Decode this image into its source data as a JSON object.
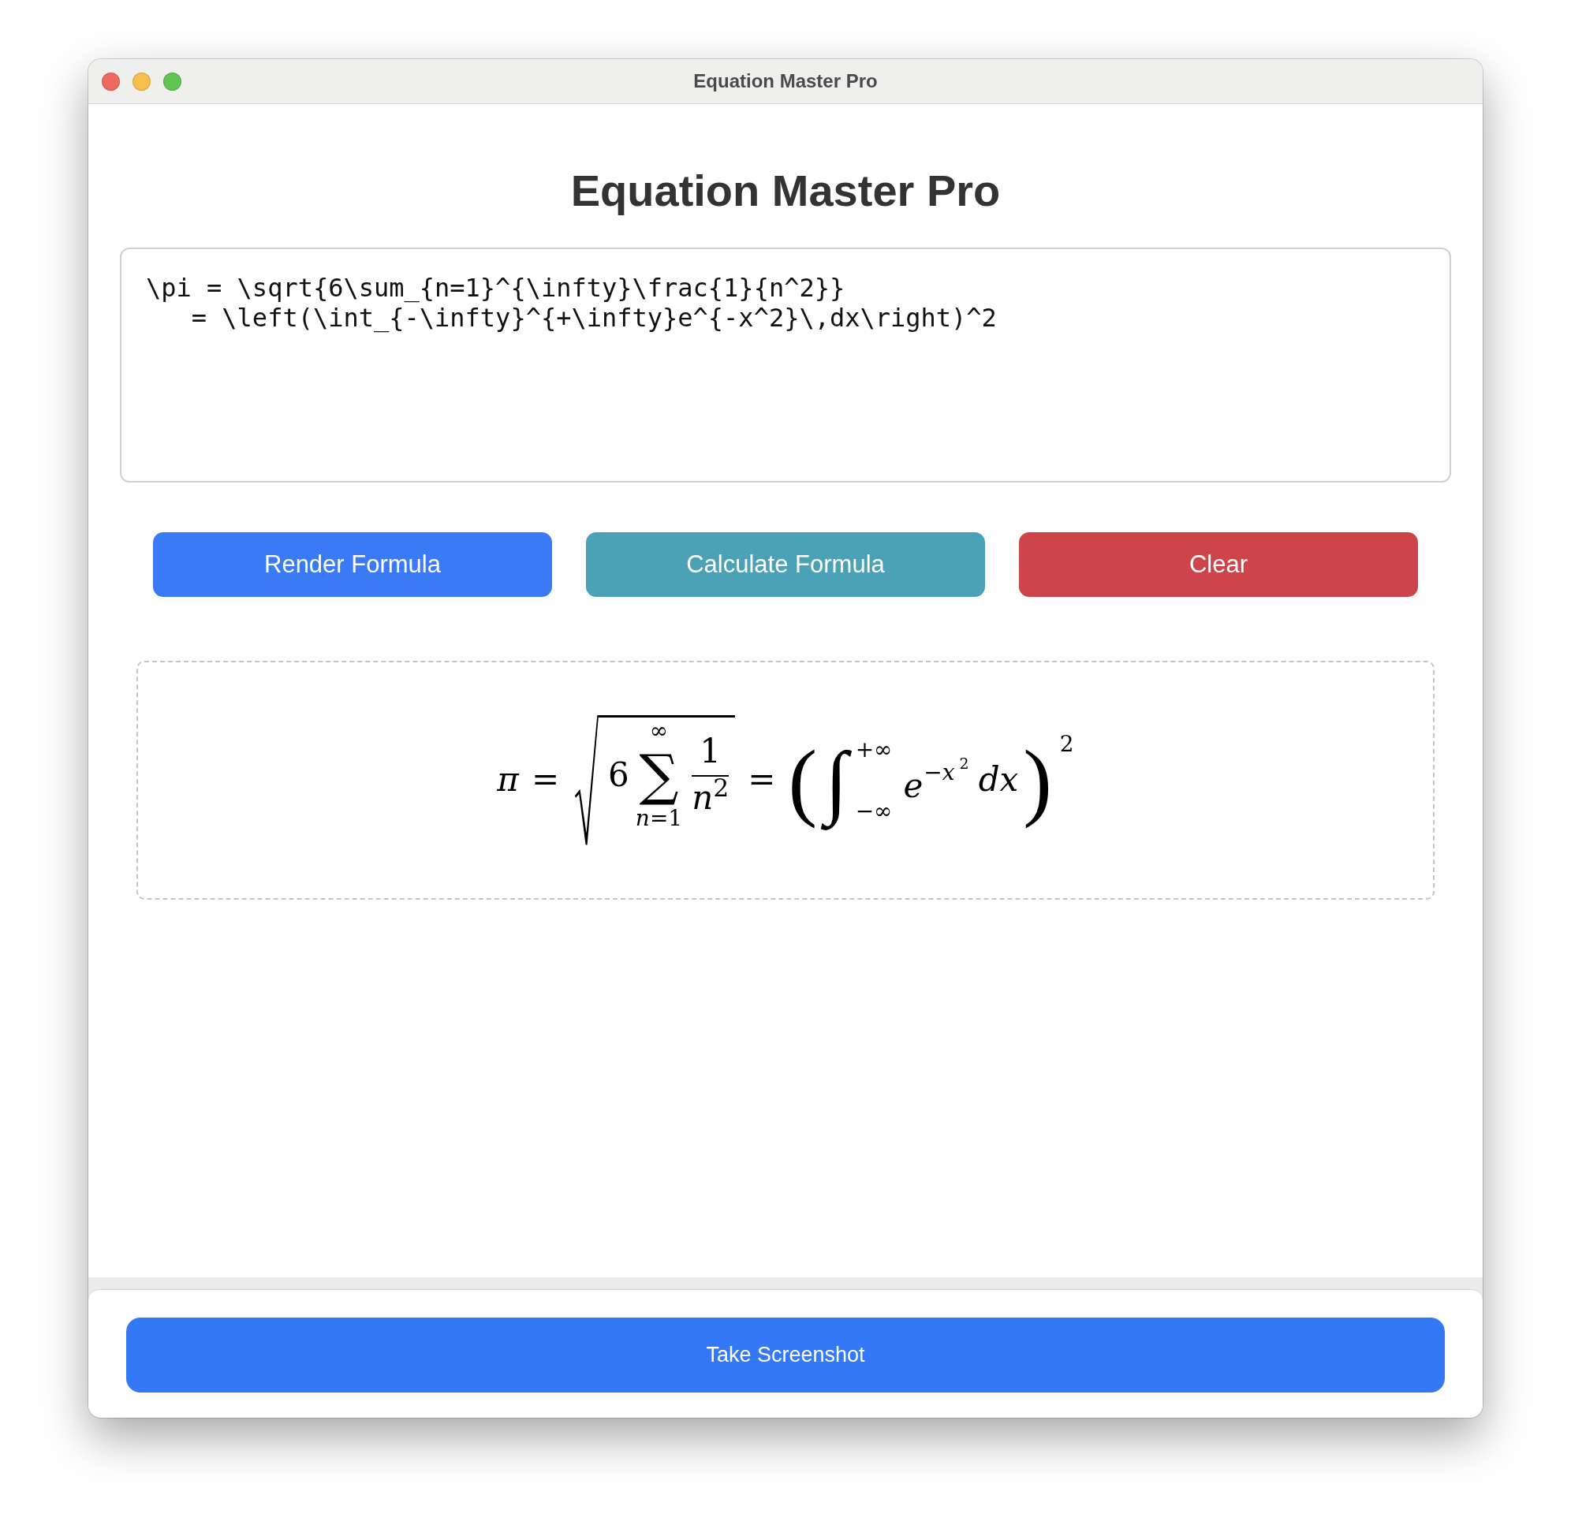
{
  "window": {
    "title": "Equation Master Pro"
  },
  "heading": "Equation Master Pro",
  "editor": {
    "value": "\\pi = \\sqrt{6\\sum_{n=1}^{\\infty}\\frac{1}{n^2}}\n   = \\left(\\int_{-\\infty}^{+\\infty}e^{-x^2}\\,dx\\right)^2"
  },
  "actions": [
    {
      "label": "Render Formula",
      "kind": "primary"
    },
    {
      "label": "Calculate Formula",
      "kind": "info"
    },
    {
      "label": "Clear",
      "kind": "danger"
    }
  ],
  "preview": {
    "terms": [
      {
        "kind": "variable",
        "text": "π"
      },
      {
        "kind": "relation",
        "text": "="
      },
      {
        "kind": "sqrt",
        "children": [
          {
            "kind": "number",
            "text": "6"
          },
          {
            "kind": "sum",
            "operator": "∑",
            "upper": "∞",
            "lower": "*n*=1"
          },
          {
            "kind": "fraction",
            "numerator": "1",
            "denominator": "*n*$^{2}$"
          }
        ]
      },
      {
        "kind": "relation",
        "text": "="
      },
      {
        "kind": "parens",
        "open": "(",
        "close": ")",
        "exponent": "2",
        "children": [
          {
            "kind": "integral",
            "operator": "∫",
            "upper": "+∞",
            "lower": "−∞"
          },
          {
            "kind": "power",
            "base": "e",
            "exponent": "−*x*",
            "exponent_power": "2"
          },
          {
            "kind": "variable",
            "text": "dx"
          }
        ]
      }
    ]
  },
  "footer": {
    "button": "Take Screenshot"
  }
}
